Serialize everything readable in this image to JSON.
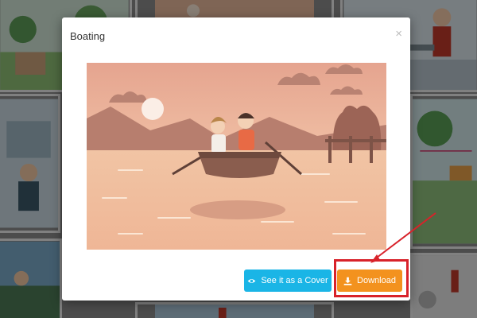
{
  "modal": {
    "title": "Boating",
    "close_symbol": "×",
    "preview_image": "boating-illustration",
    "buttons": {
      "cover_label": "See it as a Cover",
      "cover_icon": "eye-icon",
      "download_label": "Download",
      "download_icon": "download-icon"
    }
  },
  "annotation": {
    "highlight_target": "download-button",
    "color": "#d8222a"
  },
  "colors": {
    "cover_button": "#1ab5e6",
    "download_button": "#f3921e",
    "overlay": "rgba(0,0,0,0.45)"
  }
}
